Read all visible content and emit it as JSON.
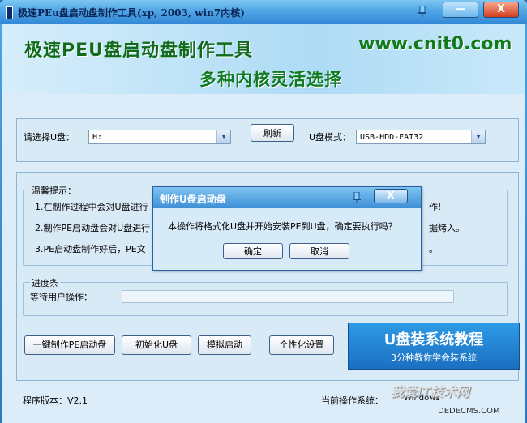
{
  "window": {
    "title": "极速PEu盘启动盘制作工具(xp, 2003, win7内核)",
    "minimize_label": "—",
    "close_label": "X"
  },
  "banner": {
    "title": "极速PEU盘启动盘制作工具",
    "subtitle": "多种内核灵活选择",
    "url": "www.cnit0.com"
  },
  "drive": {
    "label": "请选择U盘：",
    "value": "H:",
    "refresh_label": "刷新",
    "mode_label": "U盘模式：",
    "mode_value": "USB-HDD-FAT32"
  },
  "tips": {
    "title": "温馨提示：",
    "lines": [
      "1.在制作过程中会对U盘进行",
      "2.制作PE启动盘会对U盘进行",
      "3.PE启动盘制作好后，PE文"
    ],
    "tail": [
      "作!",
      "据烤入。",
      "。"
    ]
  },
  "progress": {
    "title": "进度条",
    "status": "等待用户操作：",
    "value": 0
  },
  "buttons": {
    "make": "一键制作PE启动盘",
    "init": "初始化U盘",
    "simulate": "模拟启动",
    "custom": "个性化设置"
  },
  "tutorial": {
    "title": "U盘装系统教程",
    "subtitle": "3分种教你学会装系统"
  },
  "footer": {
    "version": "程序版本：V2.1",
    "os_label": "当前操作系统：",
    "os_value": "Windows"
  },
  "dialog": {
    "title": "制作U盘启动盘",
    "close_label": "X",
    "message": "本操作将格式化U盘并开始安装PE到U盘，确定要执行吗？",
    "ok_label": "确定",
    "cancel_label": "取消"
  },
  "watermark": {
    "text": "我爱IT技术网",
    "sub": "DEDECMS.COM"
  }
}
